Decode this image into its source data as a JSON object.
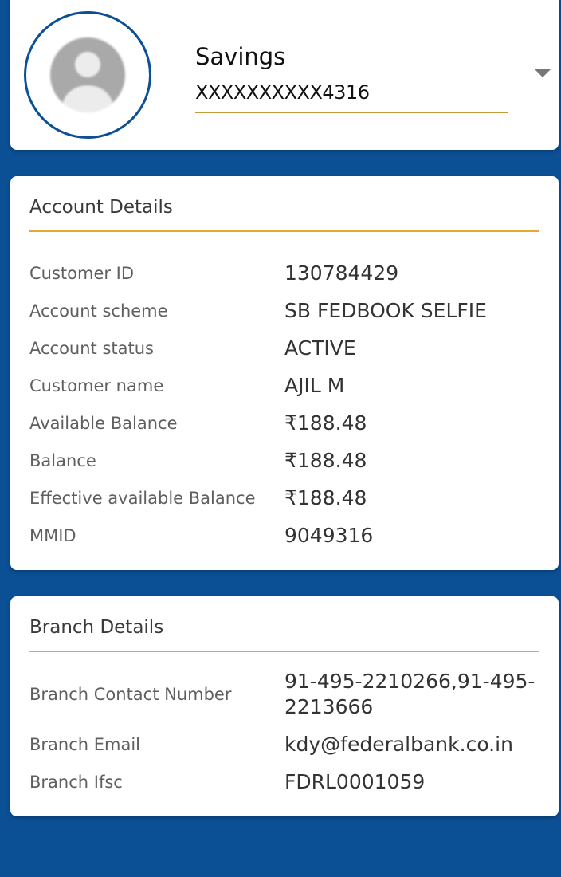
{
  "selector": {
    "account_type": "Savings",
    "account_number": "XXXXXXXXXX4316",
    "avatar_icon": "user-placeholder-icon",
    "dropdown_icon": "caret-down-icon"
  },
  "account_details": {
    "title": "Account Details",
    "rows": [
      {
        "label": "Customer ID",
        "value": "130784429"
      },
      {
        "label": "Account scheme",
        "value": "SB FEDBOOK SELFIE"
      },
      {
        "label": "Account status",
        "value": "ACTIVE"
      },
      {
        "label": "Customer name",
        "value": "AJIL M"
      },
      {
        "label": "Available Balance",
        "value": "₹188.48"
      },
      {
        "label": "Balance",
        "value": "₹188.48"
      },
      {
        "label": "Effective available Balance",
        "value": "₹188.48"
      },
      {
        "label": "MMID",
        "value": "9049316"
      }
    ]
  },
  "branch_details": {
    "title": "Branch Details",
    "rows": [
      {
        "label": "Branch Contact Number",
        "value": "91-495-2210266,91-495-2213666"
      },
      {
        "label": "Branch Email",
        "value": "kdy@federalbank.co.in"
      },
      {
        "label": "Branch Ifsc",
        "value": "FDRL0001059"
      }
    ]
  },
  "colors": {
    "background": "#0b4f95",
    "accent_divider": "#eaa534",
    "card": "#ffffff"
  }
}
